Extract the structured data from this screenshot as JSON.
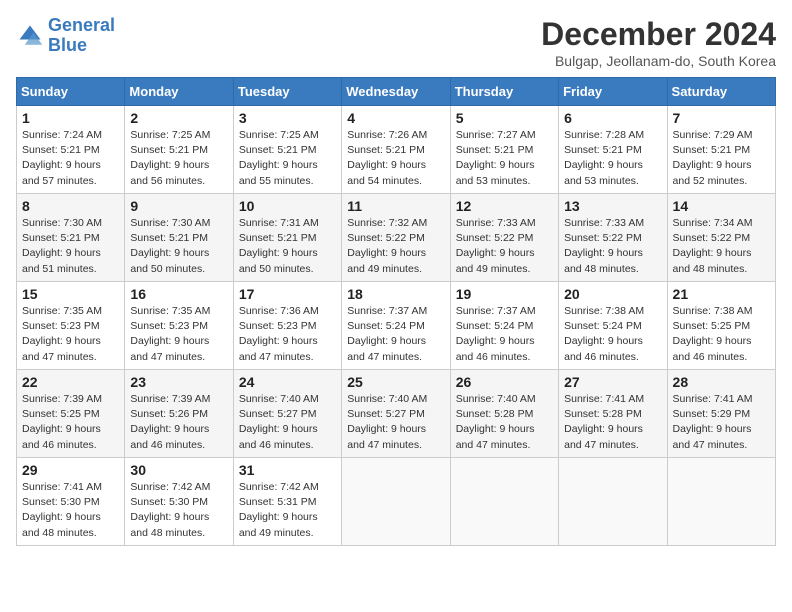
{
  "header": {
    "logo_line1": "General",
    "logo_line2": "Blue",
    "month_title": "December 2024",
    "subtitle": "Bulgap, Jeollanam-do, South Korea"
  },
  "weekdays": [
    "Sunday",
    "Monday",
    "Tuesday",
    "Wednesday",
    "Thursday",
    "Friday",
    "Saturday"
  ],
  "weeks": [
    [
      {
        "day": "1",
        "sunrise": "7:24 AM",
        "sunset": "5:21 PM",
        "daylight": "9 hours and 57 minutes."
      },
      {
        "day": "2",
        "sunrise": "7:25 AM",
        "sunset": "5:21 PM",
        "daylight": "9 hours and 56 minutes."
      },
      {
        "day": "3",
        "sunrise": "7:25 AM",
        "sunset": "5:21 PM",
        "daylight": "9 hours and 55 minutes."
      },
      {
        "day": "4",
        "sunrise": "7:26 AM",
        "sunset": "5:21 PM",
        "daylight": "9 hours and 54 minutes."
      },
      {
        "day": "5",
        "sunrise": "7:27 AM",
        "sunset": "5:21 PM",
        "daylight": "9 hours and 53 minutes."
      },
      {
        "day": "6",
        "sunrise": "7:28 AM",
        "sunset": "5:21 PM",
        "daylight": "9 hours and 53 minutes."
      },
      {
        "day": "7",
        "sunrise": "7:29 AM",
        "sunset": "5:21 PM",
        "daylight": "9 hours and 52 minutes."
      }
    ],
    [
      {
        "day": "8",
        "sunrise": "7:30 AM",
        "sunset": "5:21 PM",
        "daylight": "9 hours and 51 minutes."
      },
      {
        "day": "9",
        "sunrise": "7:30 AM",
        "sunset": "5:21 PM",
        "daylight": "9 hours and 50 minutes."
      },
      {
        "day": "10",
        "sunrise": "7:31 AM",
        "sunset": "5:21 PM",
        "daylight": "9 hours and 50 minutes."
      },
      {
        "day": "11",
        "sunrise": "7:32 AM",
        "sunset": "5:22 PM",
        "daylight": "9 hours and 49 minutes."
      },
      {
        "day": "12",
        "sunrise": "7:33 AM",
        "sunset": "5:22 PM",
        "daylight": "9 hours and 49 minutes."
      },
      {
        "day": "13",
        "sunrise": "7:33 AM",
        "sunset": "5:22 PM",
        "daylight": "9 hours and 48 minutes."
      },
      {
        "day": "14",
        "sunrise": "7:34 AM",
        "sunset": "5:22 PM",
        "daylight": "9 hours and 48 minutes."
      }
    ],
    [
      {
        "day": "15",
        "sunrise": "7:35 AM",
        "sunset": "5:23 PM",
        "daylight": "9 hours and 47 minutes."
      },
      {
        "day": "16",
        "sunrise": "7:35 AM",
        "sunset": "5:23 PM",
        "daylight": "9 hours and 47 minutes."
      },
      {
        "day": "17",
        "sunrise": "7:36 AM",
        "sunset": "5:23 PM",
        "daylight": "9 hours and 47 minutes."
      },
      {
        "day": "18",
        "sunrise": "7:37 AM",
        "sunset": "5:24 PM",
        "daylight": "9 hours and 47 minutes."
      },
      {
        "day": "19",
        "sunrise": "7:37 AM",
        "sunset": "5:24 PM",
        "daylight": "9 hours and 46 minutes."
      },
      {
        "day": "20",
        "sunrise": "7:38 AM",
        "sunset": "5:24 PM",
        "daylight": "9 hours and 46 minutes."
      },
      {
        "day": "21",
        "sunrise": "7:38 AM",
        "sunset": "5:25 PM",
        "daylight": "9 hours and 46 minutes."
      }
    ],
    [
      {
        "day": "22",
        "sunrise": "7:39 AM",
        "sunset": "5:25 PM",
        "daylight": "9 hours and 46 minutes."
      },
      {
        "day": "23",
        "sunrise": "7:39 AM",
        "sunset": "5:26 PM",
        "daylight": "9 hours and 46 minutes."
      },
      {
        "day": "24",
        "sunrise": "7:40 AM",
        "sunset": "5:27 PM",
        "daylight": "9 hours and 46 minutes."
      },
      {
        "day": "25",
        "sunrise": "7:40 AM",
        "sunset": "5:27 PM",
        "daylight": "9 hours and 47 minutes."
      },
      {
        "day": "26",
        "sunrise": "7:40 AM",
        "sunset": "5:28 PM",
        "daylight": "9 hours and 47 minutes."
      },
      {
        "day": "27",
        "sunrise": "7:41 AM",
        "sunset": "5:28 PM",
        "daylight": "9 hours and 47 minutes."
      },
      {
        "day": "28",
        "sunrise": "7:41 AM",
        "sunset": "5:29 PM",
        "daylight": "9 hours and 47 minutes."
      }
    ],
    [
      {
        "day": "29",
        "sunrise": "7:41 AM",
        "sunset": "5:30 PM",
        "daylight": "9 hours and 48 minutes."
      },
      {
        "day": "30",
        "sunrise": "7:42 AM",
        "sunset": "5:30 PM",
        "daylight": "9 hours and 48 minutes."
      },
      {
        "day": "31",
        "sunrise": "7:42 AM",
        "sunset": "5:31 PM",
        "daylight": "9 hours and 49 minutes."
      },
      null,
      null,
      null,
      null
    ]
  ]
}
